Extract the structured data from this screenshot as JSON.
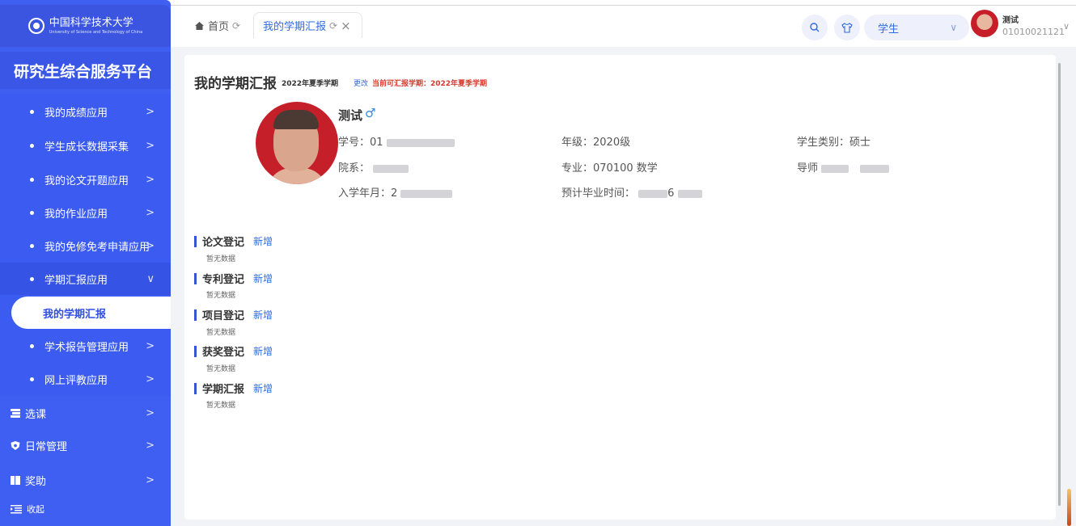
{
  "sidebar": {
    "logo_text": "中国科学技术大学",
    "logo_sub": "University of Science and Technology of China",
    "platform_title": "研究生综合服务平台",
    "sub_items": [
      {
        "label": "我的成绩应用",
        "arrow": ">"
      },
      {
        "label": "学生成长数据采集",
        "arrow": ">"
      },
      {
        "label": "我的论文开题应用",
        "arrow": ">"
      },
      {
        "label": "我的作业应用",
        "arrow": ">"
      },
      {
        "label": "我的免修免考申请应用",
        "arrow": ">"
      },
      {
        "label": "学期汇报应用",
        "arrow": "∨"
      },
      {
        "label": "我的学期汇报"
      },
      {
        "label": "学术报告管理应用",
        "arrow": ">"
      },
      {
        "label": "网上评教应用",
        "arrow": ">"
      }
    ],
    "main_items": [
      {
        "label": "选课",
        "arrow": ">"
      },
      {
        "label": "日常管理",
        "arrow": ">"
      },
      {
        "label": "奖助",
        "arrow": ">"
      }
    ],
    "collapse_label": "收起"
  },
  "topbar": {
    "home_tab": "首页",
    "active_tab": "我的学期汇报",
    "role": "学生",
    "user_name": "测试",
    "user_id": "01010021121"
  },
  "page": {
    "title": "我的学期汇报",
    "term": "2022年夏季学期",
    "change_link": "更改",
    "current_term": "当前可汇报学期：2022年夏季学期"
  },
  "student": {
    "name": "测试",
    "gender_symbol": "♂",
    "id_label": "学号：",
    "id_value": "01",
    "grade_label": "年级：",
    "grade_value": "2020级",
    "type_label": "学生类别：",
    "type_value": "硕士",
    "dept_label": "院系：",
    "major_label": "专业：",
    "major_value": "070100 数学",
    "advisor_label": "导师",
    "enroll_label": "入学年月：",
    "enroll_value": "2",
    "grad_label": "预计毕业时间：",
    "grad_value": "6"
  },
  "sections": [
    {
      "title": "论文登记",
      "add": "新增",
      "empty": "暂无数据"
    },
    {
      "title": "专利登记",
      "add": "新增",
      "empty": "暂无数据"
    },
    {
      "title": "项目登记",
      "add": "新增",
      "empty": "暂无数据"
    },
    {
      "title": "获奖登记",
      "add": "新增",
      "empty": "暂无数据"
    },
    {
      "title": "学期汇报",
      "add": "新增",
      "empty": "暂无数据"
    }
  ]
}
